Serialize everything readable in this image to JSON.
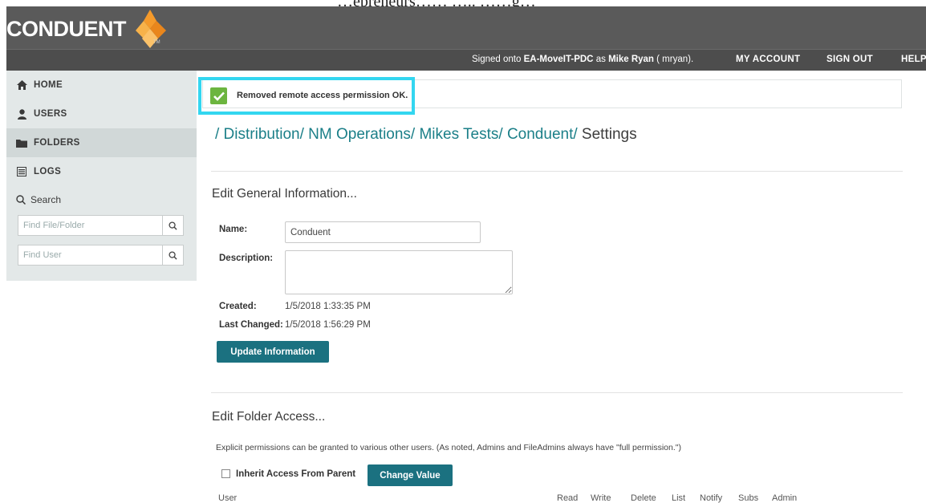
{
  "caption": "…epreneurs…… ….. ……g…",
  "app": {
    "logo_text": "CONDUENT",
    "logo_tm": "TM"
  },
  "header": {
    "signed_prefix": "Signed onto",
    "server": "EA-MoveIT-PDC",
    "as_text": "as",
    "user_name": "Mike Ryan",
    "user_id": "( mryan).",
    "nav": [
      "MY ACCOUNT",
      "SIGN OUT",
      "HELP"
    ]
  },
  "sidebar": {
    "items": [
      {
        "label": "HOME",
        "icon": "home-icon"
      },
      {
        "label": "USERS",
        "icon": "user-icon"
      },
      {
        "label": "FOLDERS",
        "icon": "folder-icon",
        "active": true
      },
      {
        "label": "LOGS",
        "icon": "log-icon"
      }
    ],
    "search_label": "Search",
    "find_file_placeholder": "Find File/Folder",
    "find_user_placeholder": "Find User"
  },
  "notice": {
    "text": "Removed remote access permission OK.",
    "icon": "checkmark-icon",
    "color": "#6cb53f"
  },
  "breadcrumb": {
    "parts": [
      "/ Distribution/",
      "NM Operations/",
      "Mikes Tests/",
      "Conduent/"
    ],
    "current": "Settings"
  },
  "general": {
    "heading": "Edit General Information...",
    "name_label": "Name:",
    "name_value": "Conduent",
    "description_label": "Description:",
    "description_value": "",
    "created_label": "Created:",
    "created_value": "1/5/2018 1:33:35 PM",
    "changed_label": "Last Changed:",
    "changed_value": "1/5/2018 1:56:29 PM",
    "update_button": "Update Information"
  },
  "access": {
    "heading": "Edit Folder Access...",
    "note": "Explicit permissions can be granted to various other users. (As noted, Admins and FileAdmins always have \"full permission.\")",
    "inherit_label": "Inherit Access From Parent",
    "inherit_checked": false,
    "change_button": "Change Value",
    "columns": [
      "User",
      "Read",
      "Write",
      "Delete",
      "List",
      "Notify",
      "Subs",
      "Admin"
    ]
  },
  "colors": {
    "accent": "#1b7180",
    "link": "#1b7f88",
    "highlight": "#33d6f0",
    "header": "#555555"
  }
}
